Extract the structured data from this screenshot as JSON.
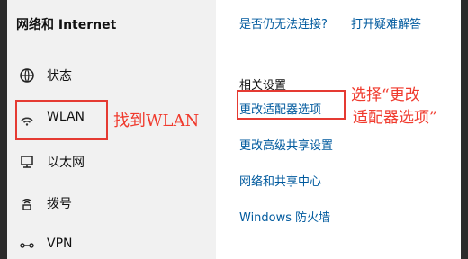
{
  "window": {
    "title": "网络和 Internet"
  },
  "sidebar": {
    "items": [
      {
        "label": "状态",
        "icon": "globe-icon"
      },
      {
        "label": "WLAN",
        "icon": "wifi-icon"
      },
      {
        "label": "以太网",
        "icon": "ethernet-icon"
      },
      {
        "label": "拨号",
        "icon": "dialup-icon"
      },
      {
        "label": "VPN",
        "icon": "vpn-icon"
      }
    ]
  },
  "top_links": {
    "left": "是否仍无法连接?",
    "right": "打开疑难解答"
  },
  "related": {
    "heading": "相关设置",
    "links": [
      "更改适配器选项",
      "更改高级共享设置",
      "网络和共享中心",
      "Windows 防火墙"
    ]
  },
  "annotations": {
    "left_note": "找到WLAN",
    "right_note_line1": "选择“更改",
    "right_note_line2": "适配器选项”"
  },
  "colors": {
    "link": "#005a9e",
    "annotation": "#f03a2d",
    "highlight": "#e53a32"
  }
}
